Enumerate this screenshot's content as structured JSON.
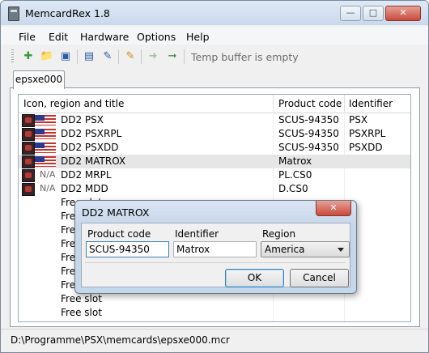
{
  "window": {
    "title": "MemcardRex 1.8"
  },
  "menu": [
    "File",
    "Edit",
    "Hardware",
    "Options",
    "Help"
  ],
  "toolbar": {
    "status": "Temp buffer is empty"
  },
  "tab": {
    "label": "epsxe000"
  },
  "columns": [
    "Icon, region and title",
    "Product code",
    "Identifier"
  ],
  "rows": [
    {
      "title": "DD2  PSX",
      "region": "",
      "product": "SCUS-94350",
      "identifier": "PSX"
    },
    {
      "title": "DD2  PSXRPL",
      "region": "",
      "product": "SCUS-94350",
      "identifier": "PSXRPL"
    },
    {
      "title": "DD2  PSXDD",
      "region": "",
      "product": "SCUS-94350",
      "identifier": "PSXDD"
    },
    {
      "title": "DD2  MATROX",
      "region": "",
      "product": "Matrox",
      "identifier": ""
    },
    {
      "title": "DD2  MRPL",
      "region": "N/A",
      "product": "PL.CS0",
      "identifier": ""
    },
    {
      "title": "DD2  MDD",
      "region": "N/A",
      "product": "D.CS0",
      "identifier": ""
    },
    {
      "title": "Free slot",
      "region": "",
      "product": "",
      "identifier": ""
    },
    {
      "title": "Free slot",
      "region": "",
      "product": "",
      "identifier": ""
    },
    {
      "title": "Free slot",
      "region": "",
      "product": "",
      "identifier": ""
    },
    {
      "title": "Free slot",
      "region": "",
      "product": "",
      "identifier": ""
    },
    {
      "title": "Free slot",
      "region": "",
      "product": "",
      "identifier": ""
    },
    {
      "title": "Free slot",
      "region": "",
      "product": "",
      "identifier": ""
    },
    {
      "title": "Free slot",
      "region": "",
      "product": "",
      "identifier": ""
    },
    {
      "title": "Free slot",
      "region": "",
      "product": "",
      "identifier": ""
    },
    {
      "title": "Free slot",
      "region": "",
      "product": "",
      "identifier": ""
    }
  ],
  "dialog": {
    "title": "DD2  MATROX",
    "product_code_label": "Product code",
    "product_code": "SCUS-94350",
    "identifier_label": "Identifier",
    "identifier": "Matrox",
    "region_label": "Region",
    "region": "America",
    "ok": "OK",
    "cancel": "Cancel"
  },
  "status": "D:\\Programme\\PSX\\memcards\\epsxe000.mcr"
}
